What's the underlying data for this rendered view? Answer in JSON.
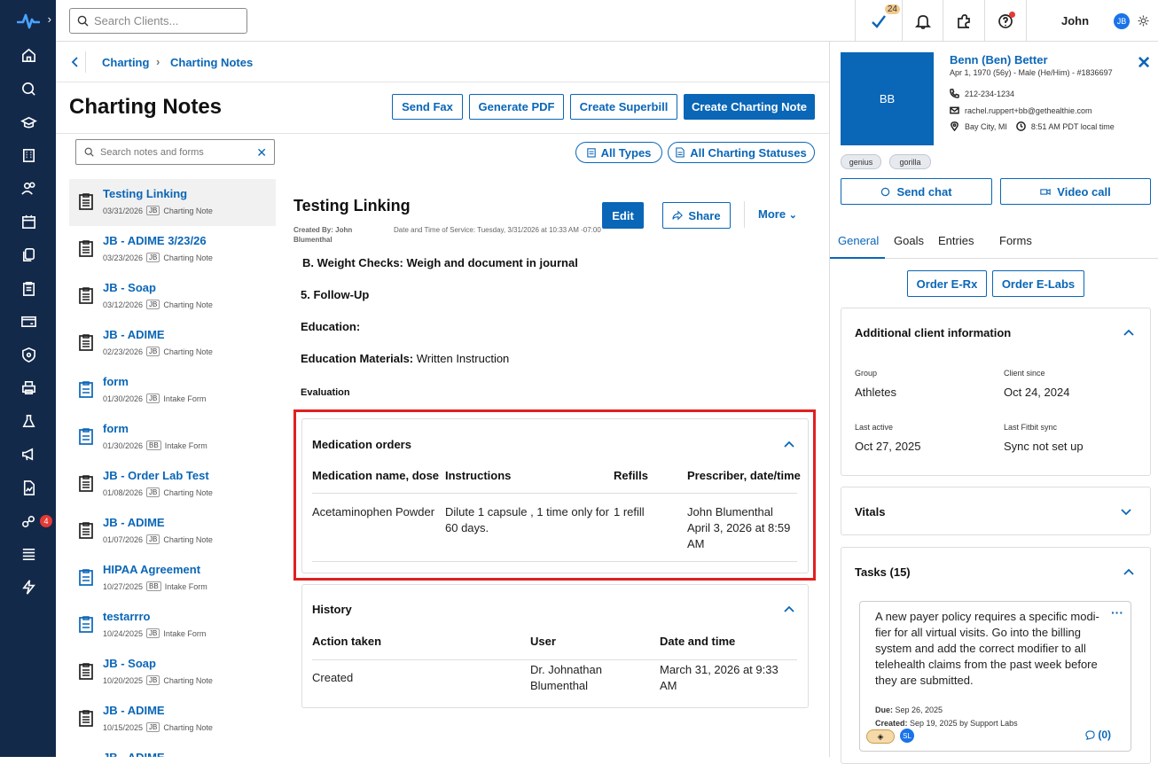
{
  "topbar": {
    "search_placeholder": "Search Clients...",
    "task_count": "24",
    "user_name": "John",
    "user_initials": "JB"
  },
  "nav": {
    "badge_count": "4"
  },
  "breadcrumb": {
    "items": [
      "Charting",
      "Charting Notes"
    ]
  },
  "page": {
    "title": "Charting Notes",
    "buttons": {
      "send_fax": "Send Fax",
      "generate_pdf": "Generate PDF",
      "create_superbill": "Create Superbill",
      "create_note": "Create Charting Note"
    },
    "notes_search_placeholder": "Search notes and forms",
    "filter_types": "All Types",
    "filter_statuses": "All Charting Statuses"
  },
  "notes": [
    {
      "title": "Testing Linking",
      "date": "03/31/2026",
      "initials": "JB",
      "type": "Charting Note",
      "kind": "note"
    },
    {
      "title": "JB - ADIME 3/23/26",
      "date": "03/23/2026",
      "initials": "JB",
      "type": "Charting Note",
      "kind": "note"
    },
    {
      "title": "JB - Soap",
      "date": "03/12/2026",
      "initials": "JB",
      "type": "Charting Note",
      "kind": "note"
    },
    {
      "title": "JB - ADIME",
      "date": "02/23/2026",
      "initials": "JB",
      "type": "Charting Note",
      "kind": "note"
    },
    {
      "title": "form",
      "date": "01/30/2026",
      "initials": "JB",
      "type": "Intake Form",
      "kind": "form"
    },
    {
      "title": "form",
      "date": "01/30/2026",
      "initials": "BB",
      "type": "Intake Form",
      "kind": "form"
    },
    {
      "title": "JB - Order Lab Test",
      "date": "01/08/2026",
      "initials": "JB",
      "type": "Charting Note",
      "kind": "note"
    },
    {
      "title": "JB - ADIME",
      "date": "01/07/2026",
      "initials": "JB",
      "type": "Charting Note",
      "kind": "note"
    },
    {
      "title": "HIPAA Agreement",
      "date": "10/27/2025",
      "initials": "BB",
      "type": "Intake Form",
      "kind": "form"
    },
    {
      "title": "testarrro",
      "date": "10/24/2025",
      "initials": "JB",
      "type": "Intake Form",
      "kind": "form"
    },
    {
      "title": "JB - Soap",
      "date": "10/20/2025",
      "initials": "JB",
      "type": "Charting Note",
      "kind": "note"
    },
    {
      "title": "JB - ADIME",
      "date": "10/15/2025",
      "initials": "JB",
      "type": "Charting Note",
      "kind": "note"
    },
    {
      "title": "JB - ADIME",
      "date": "",
      "initials": "",
      "type": "",
      "kind": "note"
    }
  ],
  "note": {
    "title": "Testing Linking",
    "created_label": "Created By:",
    "created_by": "John Blumenthal",
    "service_label": "Date and Time of Service:",
    "service_value": "Tuesday, 3/31/2026 at 10:33 AM -07:00",
    "edit": "Edit",
    "share": "Share",
    "more": "More",
    "line_weight": "B. Weight Checks: Weigh and document in journal",
    "line_followup": "5. Follow-Up",
    "line_education": "Education:",
    "edu_materials_label": "Education Materials:",
    "edu_materials_value": "Written Instruction",
    "evaluation": "Evaluation"
  },
  "medication": {
    "header": "Medication orders",
    "columns": [
      "Medication name, dose",
      "Instructions",
      "Refills",
      "Prescriber, date/time"
    ],
    "row": {
      "name": "Acetaminophen Powder",
      "instructions": "Dilute 1 capsule , 1 time only for 60 days.",
      "refills": "1 refill",
      "prescriber": "John Blumenthal",
      "datetime": "April 3, 2026 at 8:59 AM"
    }
  },
  "history": {
    "header": "History",
    "columns": [
      "Action taken",
      "User",
      "Date and time"
    ],
    "row": {
      "action": "Created",
      "user": "Dr. Johnathan Blumenthal",
      "datetime": "March 31, 2026 at 9:33 AM"
    }
  },
  "client": {
    "initials": "BB",
    "name": "Benn (Ben) Better",
    "details": "Apr 1, 1970 (56y) - Male (He/Him) - #1836697",
    "phone": "212-234-1234",
    "email": "rachel.ruppert+bb@gethealthie.com",
    "location": "Bay City, MI",
    "local_time": "8:51 AM PDT local time",
    "tags": [
      "genius",
      "gorilla"
    ],
    "send_chat": "Send chat",
    "video_call": "Video call",
    "tabs": [
      "General",
      "Goals",
      "Entries",
      "Forms"
    ],
    "order_erx": "Order E-Rx",
    "order_elabs": "Order E-Labs"
  },
  "additional": {
    "header": "Additional client information",
    "group_label": "Group",
    "group_value": "Athletes",
    "since_label": "Client since",
    "since_value": "Oct 24, 2024",
    "active_label": "Last active",
    "active_value": "Oct 27, 2025",
    "fitbit_label": "Last Fitbit sync",
    "fitbit_value": "Sync not set up"
  },
  "vitals": {
    "header": "Vitals"
  },
  "tasks": {
    "header": "Tasks (15)",
    "text": "A new payer policy requires a specific modi-fier for all virtual visits. Go into the billing system and add the correct modifier to all telehealth claims from the past week before they are submitted.",
    "due_label": "Due:",
    "due_value": "Sep 26, 2025",
    "created_label": "Created:",
    "created_value": "Sep 19, 2025 by Support Labs",
    "assignee": "SL",
    "comments": "(0)"
  }
}
